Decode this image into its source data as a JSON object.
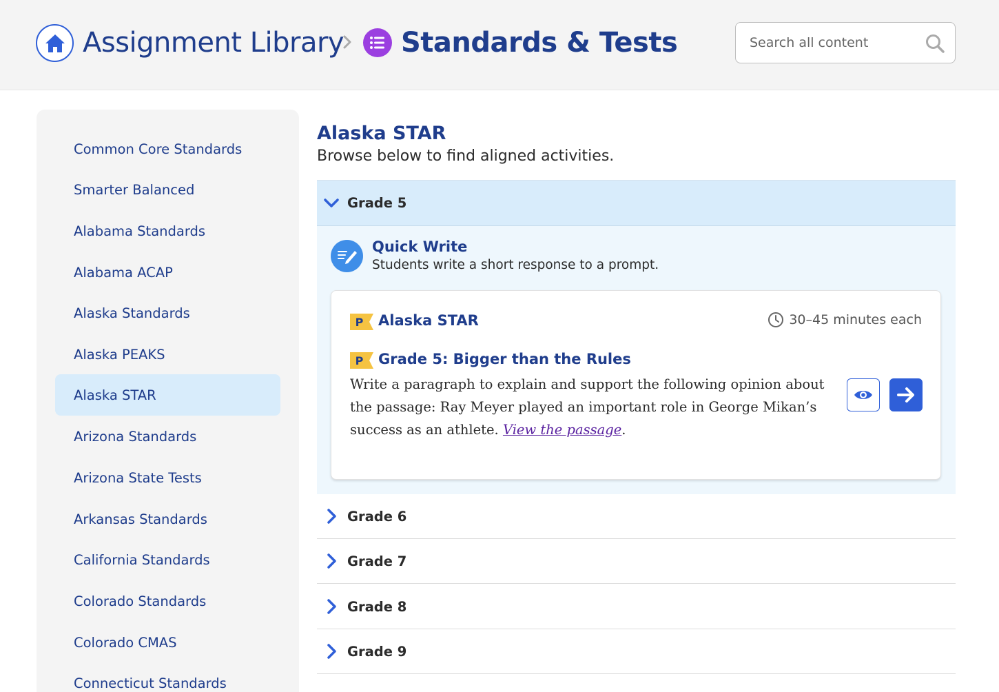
{
  "header": {
    "breadcrumb_root": "Assignment Library",
    "breadcrumb_current": "Standards & Tests",
    "search_placeholder": "Search all content"
  },
  "sidebar": {
    "items": [
      {
        "label": "Common Core Standards"
      },
      {
        "label": "Smarter Balanced"
      },
      {
        "label": "Alabama Standards"
      },
      {
        "label": "Alabama ACAP"
      },
      {
        "label": "Alaska Standards"
      },
      {
        "label": "Alaska PEAKS"
      },
      {
        "label": "Alaska STAR"
      },
      {
        "label": "Arizona Standards"
      },
      {
        "label": "Arizona State Tests"
      },
      {
        "label": "Arkansas Standards"
      },
      {
        "label": "California Standards"
      },
      {
        "label": "Colorado Standards"
      },
      {
        "label": "Colorado CMAS"
      },
      {
        "label": "Connecticut Standards"
      }
    ],
    "active_label": "Alaska STAR"
  },
  "main": {
    "title": "Alaska STAR",
    "subtitle": "Browse below to find aligned activities.",
    "open_grade": {
      "label": "Grade 5",
      "activity": {
        "title": "Quick Write",
        "description": "Students write a short response to a prompt."
      },
      "card": {
        "flag_letter": "P",
        "standard": "Alaska STAR",
        "time": "30–45 minutes each",
        "item_flag_letter": "P",
        "item_title": "Grade 5: Bigger than the Rules",
        "body_text": "Write a paragraph to explain and support the following opinion about the passage: Ray Meyer played an important role in George Mikan’s success as an athlete.",
        "link_text": "View the passage",
        "after_link": "."
      }
    },
    "grades": [
      {
        "label": "Grade 6"
      },
      {
        "label": "Grade 7"
      },
      {
        "label": "Grade 8"
      },
      {
        "label": "Grade 9"
      }
    ]
  },
  "colors": {
    "brand_blue": "#1f3d8c",
    "accent_blue": "#2f5fd8",
    "purple": "#9b3fe0",
    "active_bg": "#d8ecfb",
    "flag_yellow": "#f5c342"
  }
}
